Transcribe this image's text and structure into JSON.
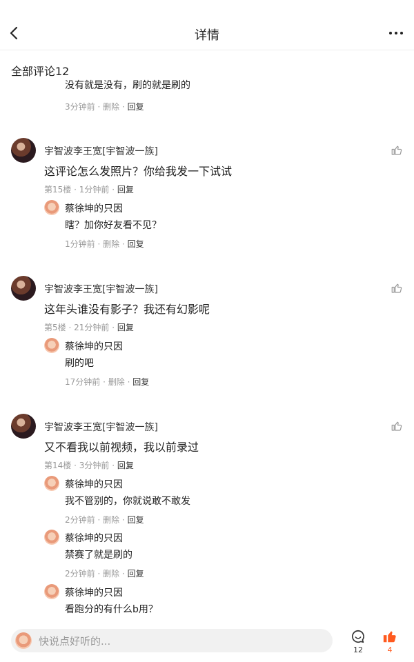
{
  "header": {
    "title": "详情"
  },
  "section": {
    "label": "全部评论12"
  },
  "truncated": {
    "text": "没有就是没有，刷的就是刷的",
    "time": "3分钟前",
    "delete": "删除",
    "reply": "回复"
  },
  "comments": [
    {
      "user": "宇智波李王宽[宇智波一族]",
      "text": "这评论怎么发照片？你给我发一下试试",
      "floor": "第15楼",
      "time": "1分钟前",
      "reply": "回复",
      "replies": [
        {
          "user": "蔡徐坤的只因",
          "text": "瞎？加你好友看不见？",
          "time": "1分钟前",
          "delete": "删除",
          "reply": "回复"
        }
      ]
    },
    {
      "user": "宇智波李王宽[宇智波一族]",
      "text": "这年头谁没有影子？我还有幻影呢",
      "floor": "第5楼",
      "time": "21分钟前",
      "reply": "回复",
      "replies": [
        {
          "user": "蔡徐坤的只因",
          "text": "刷的吧",
          "time": "17分钟前",
          "delete": "删除",
          "reply": "回复"
        }
      ]
    },
    {
      "user": "宇智波李王宽[宇智波一族]",
      "text": "又不看我以前视频，我以前录过",
      "floor": "第14楼",
      "time": "3分钟前",
      "reply": "回复",
      "replies": [
        {
          "user": "蔡徐坤的只因",
          "text": "我不管别的，你就说敢不敢发",
          "time": "2分钟前",
          "delete": "删除",
          "reply": "回复"
        },
        {
          "user": "蔡徐坤的只因",
          "text": "禁赛了就是刷的",
          "time": "2分钟前",
          "delete": "删除",
          "reply": "回复"
        },
        {
          "user": "蔡徐坤的只因",
          "text": "看跑分的有什么b用？"
        }
      ]
    }
  ],
  "bottom": {
    "placeholder": "快说点好听的...",
    "comment_count": "12",
    "like_count": "4",
    "like_color": "#ff5a1f"
  }
}
